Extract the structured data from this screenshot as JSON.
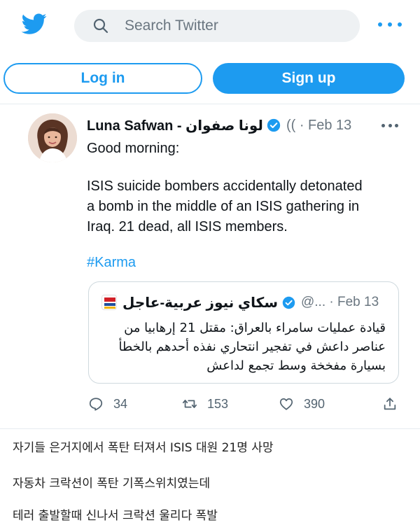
{
  "header": {
    "logo_icon": "twitter-bird-icon",
    "search_placeholder": "Search Twitter",
    "search_icon": "search-icon",
    "more_icon": "more-dots-icon"
  },
  "auth": {
    "login_label": "Log in",
    "signup_label": "Sign up"
  },
  "tweet": {
    "author_name": "Luna Safwan - لونا صفوان",
    "handle_date": "(( · Feb 13",
    "lines": [
      "Good morning:",
      "",
      "ISIS suicide bombers accidentally detonated",
      "a bomb in the middle of an ISIS gathering in",
      "Iraq. 21 dead, all ISIS members."
    ],
    "hashtag": "#Karma",
    "quoted": {
      "author_name": "سكاي نيوز عربية-عاجل",
      "handle_date": "@... · Feb 13",
      "text_lines": [
        "قيادة عمليات سامراء بالعراق: مقتل 21 إرهابيا من",
        "عناصر داعش في تفجير انتحاري نفذه أحدهم بالخطأ",
        "بسيارة مفخخة وسط تجمع لداعش"
      ]
    },
    "actions": {
      "replies": "34",
      "retweets": "153",
      "likes": "390"
    }
  },
  "captions": [
    "자기들 은거지에서 폭탄 터져서 ISIS 대원 21명 사망",
    "자동차 크락션이 폭탄 기폭스위치였는데",
    "테러 출발할때 신나서 크락션 울리다 폭발"
  ],
  "colors": {
    "accent": "#1d9bf0",
    "text": "#0f1419",
    "muted": "#536471"
  }
}
